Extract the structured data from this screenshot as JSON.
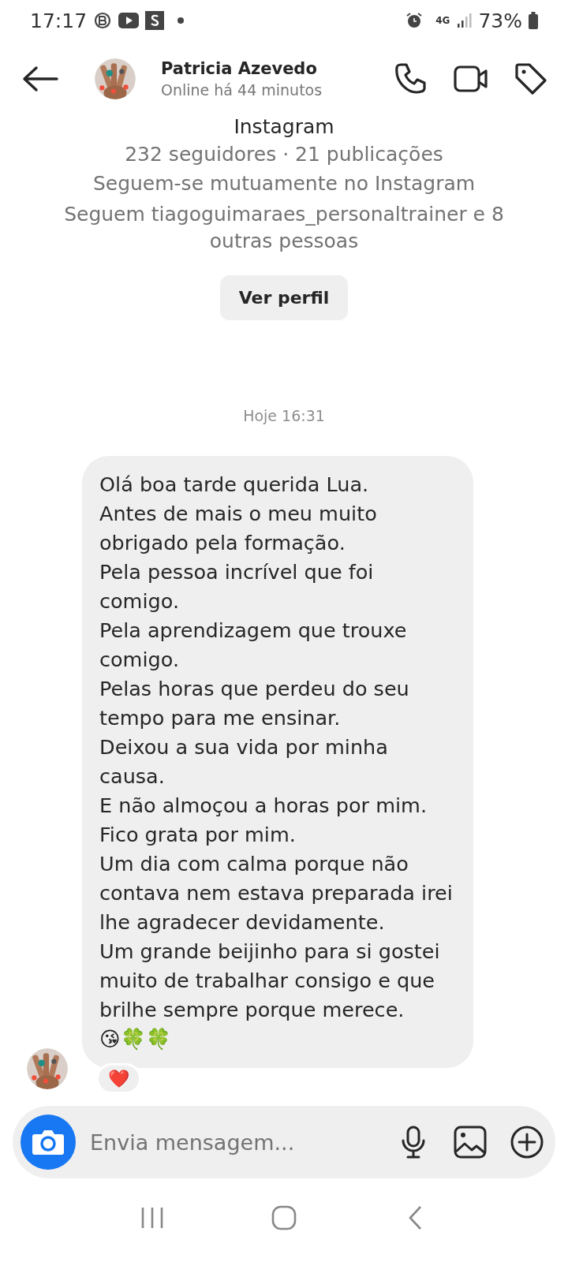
{
  "status_bar": {
    "time": "17:17",
    "battery": "73%",
    "network": "4G"
  },
  "header": {
    "name": "Patricia Azevedo",
    "status": "Online há 44 minutos"
  },
  "profile": {
    "platform": "Instagram",
    "stats": "232 seguidores · 21 publicações",
    "mutual": "Seguem-se mutuamente no Instagram",
    "followers": "Seguem tiagoguimaraes_personaltrainer e 8 outras pessoas",
    "button": "Ver perfil"
  },
  "timestamp": "Hoje 16:31",
  "message": {
    "lines": [
      "Olá boa tarde querida Lua.",
      "Antes de mais o meu muito obrigado pela formação.",
      "Pela pessoa incrível que foi comigo.",
      "Pela aprendizagem que trouxe comigo.",
      "Pelas horas que perdeu do seu tempo para me ensinar.",
      "Deixou a sua vida por minha causa.",
      "E não almoçou a horas por mim.",
      "Fico grata por mim.",
      "Um dia com calma porque não contava nem estava preparada irei lhe agradecer devidamente.",
      "Um grande beijinho para si gostei muito de trabalhar consigo e que brilhe sempre porque merece.",
      "😘🍀🍀"
    ],
    "reaction": "❤️"
  },
  "composer": {
    "placeholder": "Envia mensagem..."
  }
}
